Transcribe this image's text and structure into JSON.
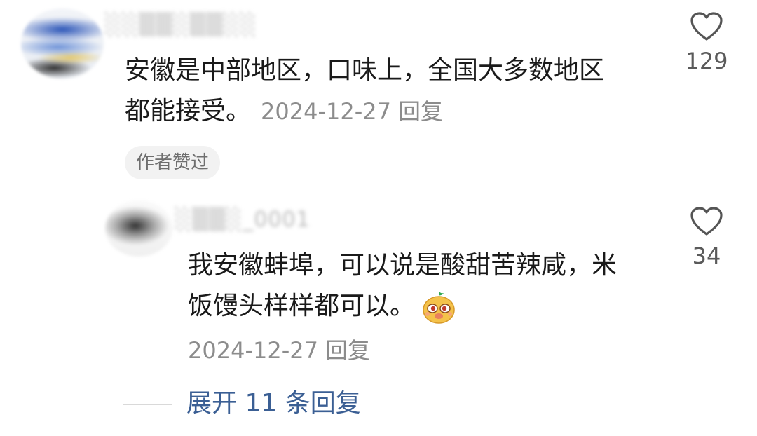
{
  "comment": {
    "author": "░░▒▒░▒▒░░",
    "text_line1": "安徽是中部地区，口味上，全国大多数地区",
    "text_line2": "都能接受。",
    "date": "2024-12-27",
    "reply_label": "回复",
    "badge": "作者赞过",
    "likes": "129",
    "like_icon": "heart-outline-icon"
  },
  "reply": {
    "author": "░▒▒░_0001",
    "text_line1": "我安徽蚌埠，可以说是酸甜苦辣咸，米",
    "text_line2": "饭馒头样样都可以。",
    "sticker_icon": "cute-face-sticker-icon",
    "date": "2024-12-27",
    "reply_label": "回复",
    "likes": "34",
    "like_icon": "heart-outline-icon"
  },
  "expand": {
    "label": "展开 11 条回复"
  },
  "colors": {
    "link": "#3b5f94",
    "muted": "#8c8c8c",
    "text": "#1a1a1a",
    "badge_bg": "#f2f2f2"
  }
}
